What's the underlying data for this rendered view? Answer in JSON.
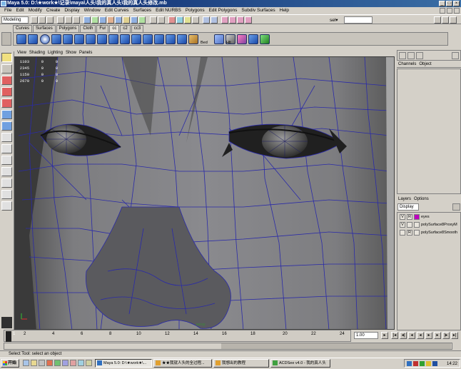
{
  "window": {
    "title": "Maya 5.0: D:\\★work★\\记录\\maya\\人头\\我的真人头\\我的真人头修改.mb"
  },
  "menus": [
    "File",
    "Edit",
    "Modify",
    "Create",
    "Display",
    "Window",
    "Edit Curves",
    "Surfaces",
    "Edit NURBS",
    "Polygons",
    "Edit Polygons",
    "Subdiv Surfaces",
    "Help"
  ],
  "status_line": {
    "mode": "Modeling",
    "sel_label": "sel▾"
  },
  "shelf": {
    "tabs": [
      "Curves",
      "Surfaces",
      "Polygons",
      "Cloth",
      "Fur",
      "cc",
      "c2",
      "cc3"
    ],
    "labels": [
      "Bed",
      "Hlt"
    ]
  },
  "viewport": {
    "menus": [
      "View",
      "Shading",
      "Lighting",
      "Show",
      "Panels"
    ],
    "hud": [
      [
        "1103",
        "0",
        "0"
      ],
      [
        "2345",
        "0",
        "0"
      ],
      [
        "1150",
        "0",
        "0"
      ],
      [
        "2670",
        "0",
        "0"
      ]
    ],
    "camera_label": "persp"
  },
  "channel_box": {
    "menus": [
      "Channels",
      "Object"
    ]
  },
  "layers": {
    "menus": [
      "Layers",
      "Options"
    ],
    "type": "Display",
    "items": [
      {
        "v": "V",
        "r": "R",
        "name": "eyes",
        "color": "#c000c0"
      },
      {
        "v": "V",
        "r": "",
        "name": "polySurface8ProxyM",
        "color": ""
      },
      {
        "v": "",
        "r": "R",
        "name": "polySurface8Smooth",
        "color": ""
      }
    ]
  },
  "time_slider": {
    "ticks": [
      "2",
      "4",
      "6",
      "8",
      "10",
      "12",
      "14",
      "16",
      "18",
      "20",
      "22",
      "24"
    ],
    "current": "1.00",
    "start_frame": "1"
  },
  "help_line": "Select Tool: select an object",
  "taskbar": {
    "start": "开始",
    "tasks": [
      "Maya 5.0: D:\\★work★\\...",
      "★★我就人头的全过程...",
      "我想出的教程",
      "ACDSee v4.0 - 我的真人头"
    ],
    "clock": "14:22"
  }
}
